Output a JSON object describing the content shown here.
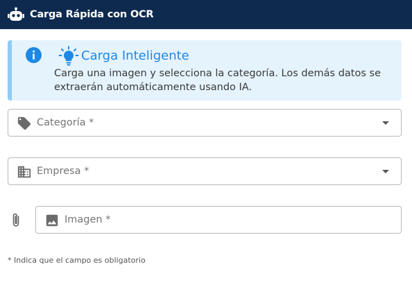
{
  "header": {
    "title": "Carga Rápida con OCR",
    "icon": "robot-icon",
    "background": "#0e2a4f"
  },
  "alert": {
    "icon": "info-icon",
    "title_icon": "lightbulb-icon",
    "title": "Carga Inteligente",
    "body": "Carga una imagen y selecciona la categoría. Los demás datos se extraerán automáticamente usando IA.",
    "accent": "#1e88e5"
  },
  "form": {
    "categoria": {
      "label": "Categoría *",
      "icon": "tag-icon",
      "type": "select"
    },
    "empresa": {
      "label": "Empresa *",
      "icon": "building-icon",
      "type": "select"
    },
    "imagen": {
      "label": "Imagen *",
      "icon": "image-icon",
      "prepend_icon": "paperclip-icon",
      "type": "file"
    }
  },
  "footnote": "* Indica que el campo es obligatorio"
}
